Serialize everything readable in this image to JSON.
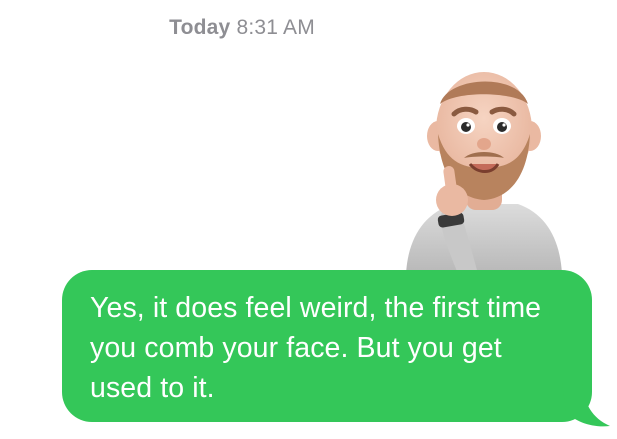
{
  "conversation": {
    "timestamp": {
      "day": "Today",
      "time": "8:31 AM"
    },
    "sticker": {
      "icon": "memoji-sticker-icon"
    },
    "message": {
      "text": "Yes, it does feel weird, the first time you comb your face. But you get used to it.",
      "bubble_color": "#34c759",
      "text_color": "#ffffff"
    }
  }
}
